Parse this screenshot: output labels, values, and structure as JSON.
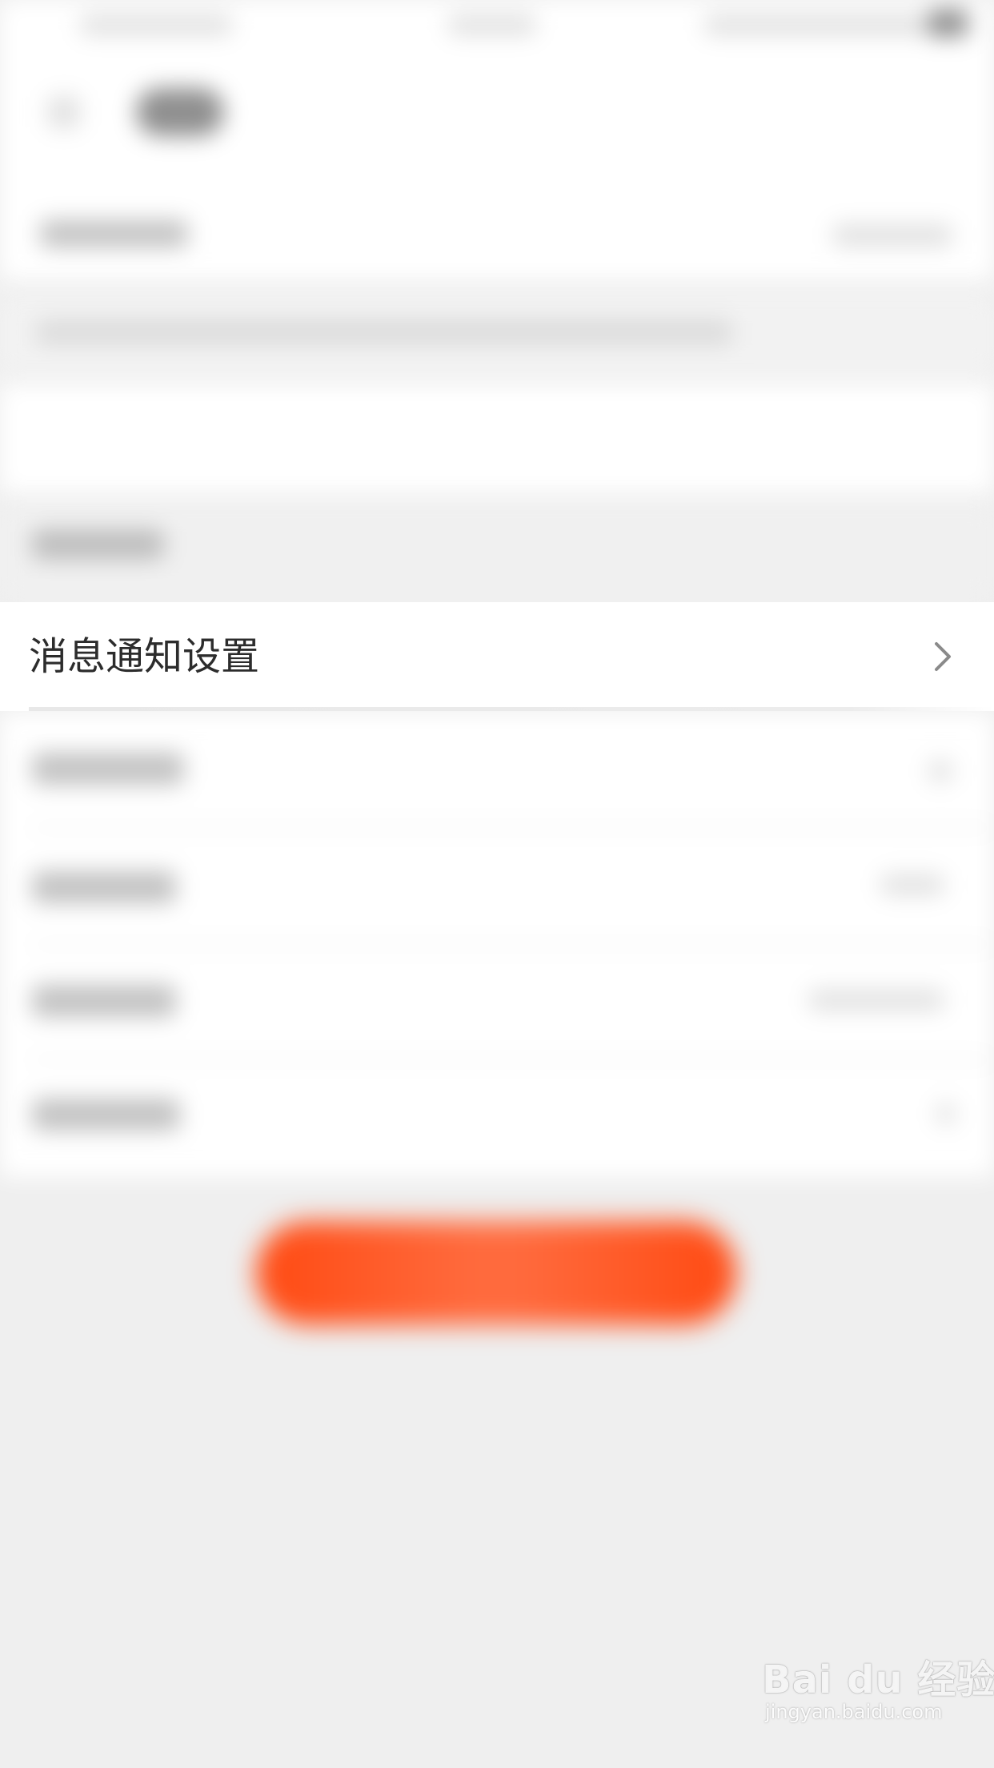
{
  "row": {
    "label": "消息通知设置"
  },
  "icons": {
    "chevron": "chevron-right-icon"
  },
  "watermark": {
    "main": "Bai du 经验",
    "sub": "jingyan.baidu.com"
  },
  "colors": {
    "accent": "#ff4a12",
    "background": "#efefef",
    "row_bg": "#ffffff",
    "text": "#2c2c2c"
  }
}
